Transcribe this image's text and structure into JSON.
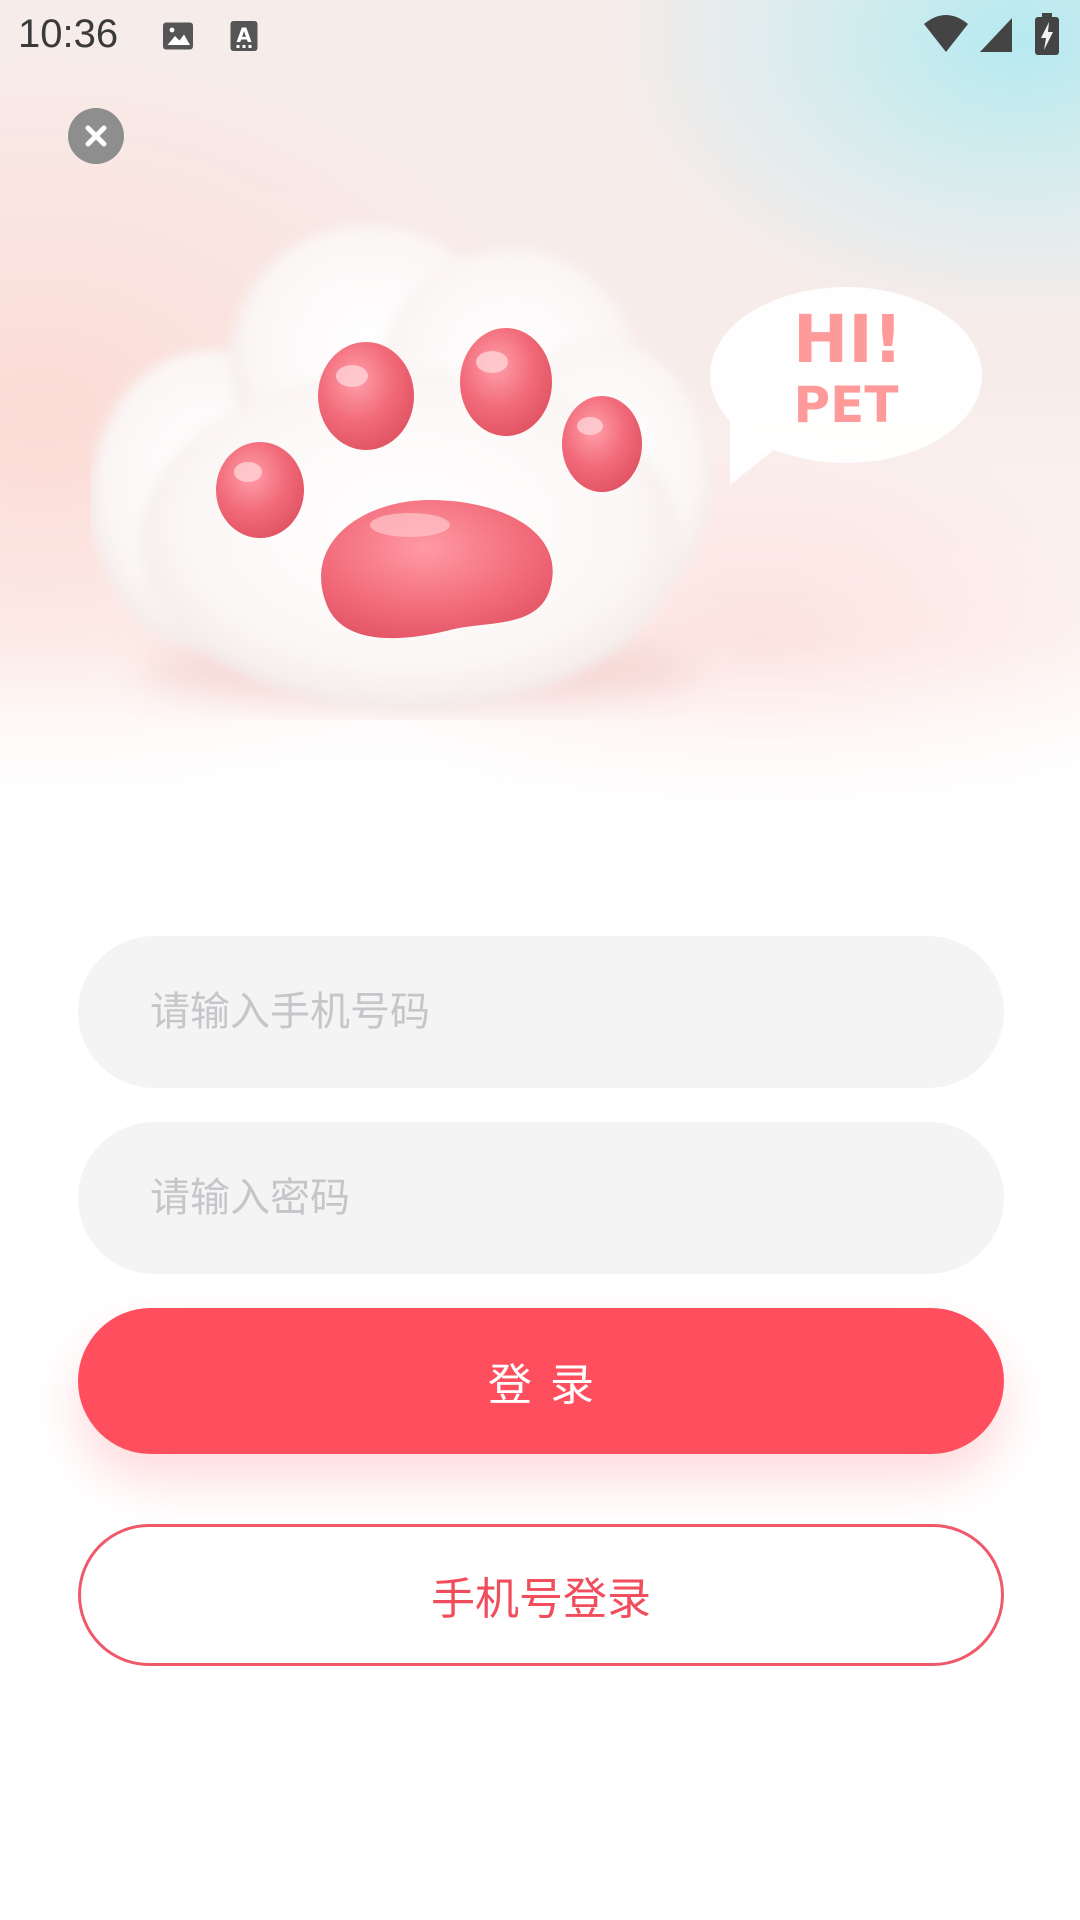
{
  "status_bar": {
    "time": "10:36",
    "icons": [
      "image-icon",
      "text-a-icon",
      "wifi-icon",
      "cell-signal-icon",
      "battery-charging-icon"
    ]
  },
  "hero": {
    "close_icon": "close-icon",
    "speech_bubble": {
      "line1": "HI!",
      "line2": "PET"
    }
  },
  "form": {
    "phone_placeholder": "请输入手机号码",
    "phone_value": "",
    "password_placeholder": "请输入密码",
    "password_value": ""
  },
  "buttons": {
    "login_label": "登录",
    "phone_login_label": "手机号登录"
  },
  "colors": {
    "accent": "#ff4f5f",
    "input_bg": "#f4f4f4",
    "placeholder": "#c6c6ca",
    "bubble_text": "#ff9a9a",
    "paw_pink": "#f26b7a"
  }
}
